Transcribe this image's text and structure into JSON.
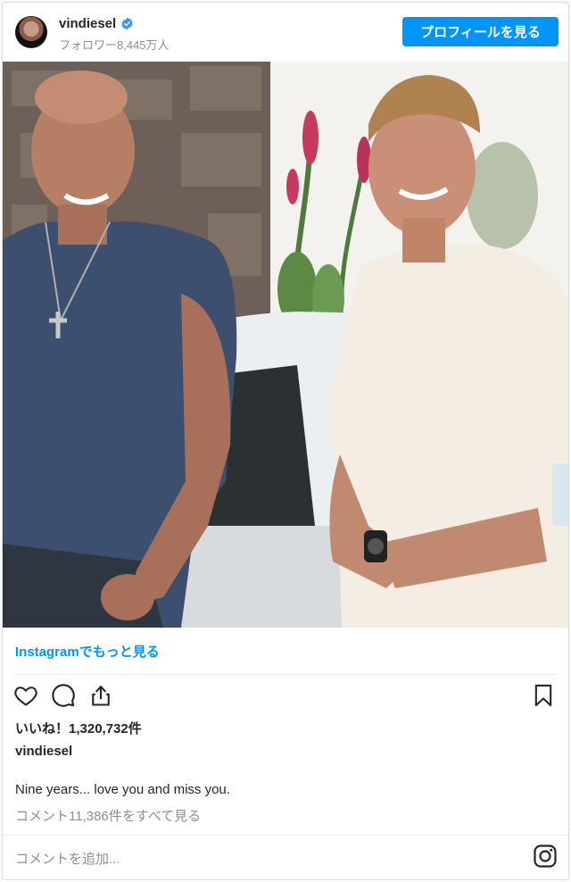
{
  "header": {
    "username": "vindiesel",
    "followers": "フォロワー8,445万人",
    "profile_button": "プロフィールを見る"
  },
  "more_link": "Instagramでもっと見る",
  "post": {
    "likes": "いいね！1,320,732件",
    "caption_user": "vindiesel",
    "caption_text": "Nine years... love you and miss you.",
    "view_comments": "コメント11,386件をすべて見る",
    "add_comment_placeholder": "コメントを追加..."
  },
  "icons": {
    "verified": "verified-badge-icon",
    "like": "heart-icon",
    "comment": "comment-icon",
    "share": "share-icon",
    "save": "bookmark-icon",
    "instagram": "instagram-logo-icon"
  },
  "colors": {
    "accent": "#0095f6",
    "text": "#262626",
    "muted": "#8e8e8e"
  }
}
